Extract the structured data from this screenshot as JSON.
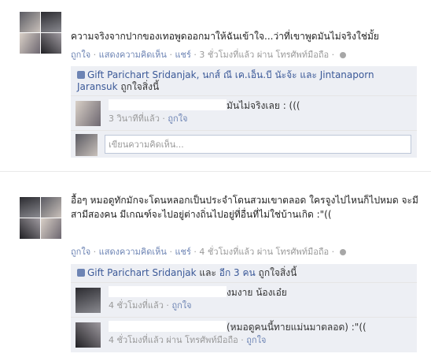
{
  "post1": {
    "status": "ความจริงจากปากของเทอพูดออกมาให้ฉันเข้าใจ...ว่าที่เขาพูดมันไม่จริงใช่มั้ย",
    "meta": {
      "like": "ถูกใจ",
      "sep": " · ",
      "comment": "แสดงความคิดเห็น",
      "share": "แชร์",
      "time": " · 3 ชั่วโมงที่แล้ว ผ่าน โทรศัพท์มือถือ · "
    },
    "likes": {
      "names": "Gift Parichart Sridanjak, นกส์ ณี เค.เอ็น.บี นัะจ้ะ และ Jintanaporn Jaransuk",
      "suffix": " ถูกใจสิ่งนี้"
    },
    "comment": {
      "text": "มันไม่จริงเลย : (((",
      "time": "3 วินาทีที่แล้ว",
      "sep": " · ",
      "like": "ถูกใจ"
    },
    "input_placeholder": "เขียนความคิดเห็น..."
  },
  "post2": {
    "status": "อื้อๆ หมอดูทักมักจะโดนหลอกเป็นประจำโดนสวมเขาตลอด ใครจูงไปไหนก็ไปหมด จะมีสามีสองคน มีเกณฑ์จะไปอยู่ต่างถิ่นไปอยู่ที่อื่นที่ไม่ใช่บ้านเกิด :\"((",
    "meta": {
      "like": "ถูกใจ",
      "sep": " · ",
      "comment": "แสดงความคิดเห็น",
      "share": "แชร์",
      "time": " · 4 ชั่วโมงที่แล้ว ผ่าน โทรศัพท์มือถือ · "
    },
    "likes": {
      "name": "Gift Parichart Sridanjak",
      "and": " และ ",
      "others": "อีก 3 คน",
      "suffix": " ถูกใจสิ่งนี้"
    },
    "comments": [
      {
        "text": "งมงาย น้องเอ๋ย",
        "time": "4 ชั่วโมงที่แล้ว",
        "sep": " · ",
        "like": "ถูกใจ"
      },
      {
        "text": "(หมอดูคนนี้ทายแม่นมาตลอด) :\"((",
        "time": "4 ชั่วโมงที่แล้ว ผ่าน โทรศัพท์มือถือ",
        "sep": " · ",
        "like": "ถูกใจ"
      }
    ]
  },
  "colors": {
    "link": "#3b5998",
    "muted": "#999999",
    "ufi_bg": "#edeff4"
  }
}
